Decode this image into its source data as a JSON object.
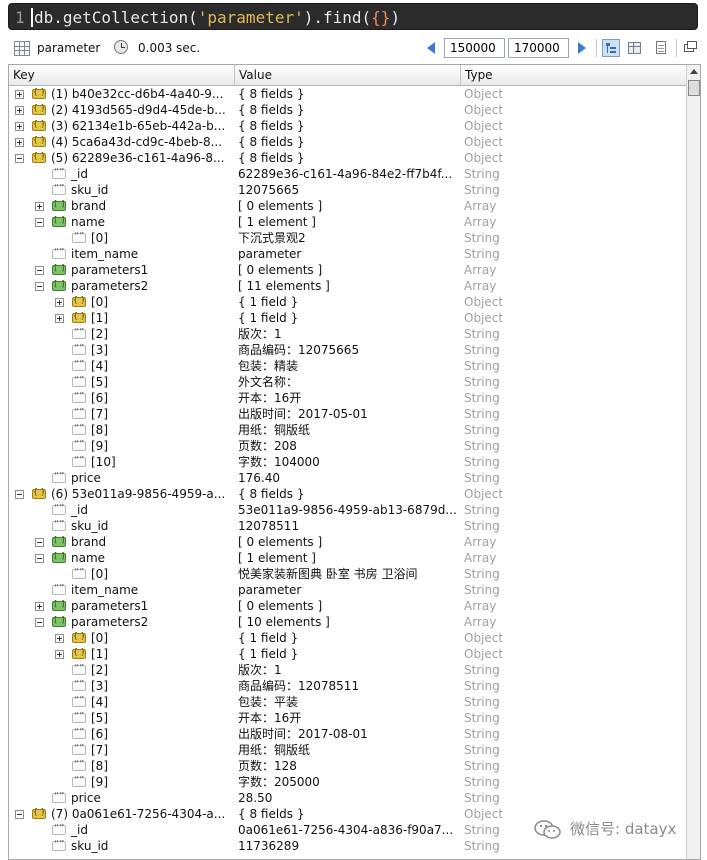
{
  "editor": {
    "line_number": "1",
    "query_prefix": "db.getCollection(",
    "query_string": "'parameter'",
    "query_middle": ").find(",
    "query_braces": "{}",
    "query_suffix": ")"
  },
  "status": {
    "collection": "parameter",
    "exec_time": "0.003 sec.",
    "skip": "150000",
    "limit": "170000"
  },
  "columns": {
    "key": "Key",
    "value": "Value",
    "type": "Type"
  },
  "rows": [
    {
      "depth": 0,
      "exp": "plus",
      "icon": "obj",
      "key": "(1) b40e32cc-d6b4-4a40-9...",
      "value": "{ 8 fields }",
      "type": "Object"
    },
    {
      "depth": 0,
      "exp": "plus",
      "icon": "obj",
      "key": "(2) 4193d565-d9d4-45de-b...",
      "value": "{ 8 fields }",
      "type": "Object"
    },
    {
      "depth": 0,
      "exp": "plus",
      "icon": "obj",
      "key": "(3) 62134e1b-65eb-442a-b...",
      "value": "{ 8 fields }",
      "type": "Object"
    },
    {
      "depth": 0,
      "exp": "plus",
      "icon": "obj",
      "key": "(4) 5ca6a43d-cd9c-4beb-8...",
      "value": "{ 8 fields }",
      "type": "Object"
    },
    {
      "depth": 0,
      "exp": "minus",
      "icon": "obj",
      "key": "(5) 62289e36-c161-4a96-8...",
      "value": "{ 8 fields }",
      "type": "Object"
    },
    {
      "depth": 1,
      "exp": "none",
      "icon": "str",
      "key": "_id",
      "value": "62289e36-c161-4a96-84e2-ff7b4f...",
      "type": "String"
    },
    {
      "depth": 1,
      "exp": "none",
      "icon": "str",
      "key": "sku_id",
      "value": "12075665",
      "type": "String"
    },
    {
      "depth": 1,
      "exp": "plus",
      "icon": "arr",
      "key": "brand",
      "value": "[ 0 elements ]",
      "type": "Array"
    },
    {
      "depth": 1,
      "exp": "minus",
      "icon": "arr",
      "key": "name",
      "value": "[ 1 element ]",
      "type": "Array"
    },
    {
      "depth": 2,
      "exp": "none",
      "icon": "str",
      "key": "[0]",
      "value": "下沉式景观2",
      "type": "String"
    },
    {
      "depth": 1,
      "exp": "none",
      "icon": "str",
      "key": "item_name",
      "value": "parameter",
      "type": "String"
    },
    {
      "depth": 1,
      "exp": "minus",
      "icon": "arr",
      "key": "parameters1",
      "value": "[ 0 elements ]",
      "type": "Array"
    },
    {
      "depth": 1,
      "exp": "minus",
      "icon": "arr",
      "key": "parameters2",
      "value": "[ 11 elements ]",
      "type": "Array"
    },
    {
      "depth": 2,
      "exp": "plus",
      "icon": "obj",
      "key": "[0]",
      "value": "{ 1 field }",
      "type": "Object"
    },
    {
      "depth": 2,
      "exp": "plus",
      "icon": "obj",
      "key": "[1]",
      "value": "{ 1 field }",
      "type": "Object"
    },
    {
      "depth": 2,
      "exp": "none",
      "icon": "str",
      "key": "[2]",
      "value": "版次：1",
      "type": "String"
    },
    {
      "depth": 2,
      "exp": "none",
      "icon": "str",
      "key": "[3]",
      "value": "商品编码：12075665",
      "type": "String"
    },
    {
      "depth": 2,
      "exp": "none",
      "icon": "str",
      "key": "[4]",
      "value": "包装：精装",
      "type": "String"
    },
    {
      "depth": 2,
      "exp": "none",
      "icon": "str",
      "key": "[5]",
      "value": "外文名称：",
      "type": "String"
    },
    {
      "depth": 2,
      "exp": "none",
      "icon": "str",
      "key": "[6]",
      "value": "开本：16开",
      "type": "String"
    },
    {
      "depth": 2,
      "exp": "none",
      "icon": "str",
      "key": "[7]",
      "value": "出版时间：2017-05-01",
      "type": "String"
    },
    {
      "depth": 2,
      "exp": "none",
      "icon": "str",
      "key": "[8]",
      "value": "用纸：铜版纸",
      "type": "String"
    },
    {
      "depth": 2,
      "exp": "none",
      "icon": "str",
      "key": "[9]",
      "value": "页数：208",
      "type": "String"
    },
    {
      "depth": 2,
      "exp": "none",
      "icon": "str",
      "key": "[10]",
      "value": "字数：104000",
      "type": "String"
    },
    {
      "depth": 1,
      "exp": "none",
      "icon": "str",
      "key": "price",
      "value": "176.40",
      "type": "String"
    },
    {
      "depth": 0,
      "exp": "minus",
      "icon": "obj",
      "key": "(6) 53e011a9-9856-4959-a...",
      "value": "{ 8 fields }",
      "type": "Object"
    },
    {
      "depth": 1,
      "exp": "none",
      "icon": "str",
      "key": "_id",
      "value": "53e011a9-9856-4959-ab13-6879d...",
      "type": "String"
    },
    {
      "depth": 1,
      "exp": "none",
      "icon": "str",
      "key": "sku_id",
      "value": "12078511",
      "type": "String"
    },
    {
      "depth": 1,
      "exp": "minus",
      "icon": "arr",
      "key": "brand",
      "value": "[ 0 elements ]",
      "type": "Array"
    },
    {
      "depth": 1,
      "exp": "minus",
      "icon": "arr",
      "key": "name",
      "value": "[ 1 element ]",
      "type": "Array"
    },
    {
      "depth": 2,
      "exp": "none",
      "icon": "str",
      "key": "[0]",
      "value": "悦美家装新图典 卧室 书房 卫浴间",
      "type": "String"
    },
    {
      "depth": 1,
      "exp": "none",
      "icon": "str",
      "key": "item_name",
      "value": "parameter",
      "type": "String"
    },
    {
      "depth": 1,
      "exp": "plus",
      "icon": "arr",
      "key": "parameters1",
      "value": "[ 0 elements ]",
      "type": "Array"
    },
    {
      "depth": 1,
      "exp": "minus",
      "icon": "arr",
      "key": "parameters2",
      "value": "[ 10 elements ]",
      "type": "Array"
    },
    {
      "depth": 2,
      "exp": "plus",
      "icon": "obj",
      "key": "[0]",
      "value": "{ 1 field }",
      "type": "Object"
    },
    {
      "depth": 2,
      "exp": "plus",
      "icon": "obj",
      "key": "[1]",
      "value": "{ 1 field }",
      "type": "Object"
    },
    {
      "depth": 2,
      "exp": "none",
      "icon": "str",
      "key": "[2]",
      "value": "版次：1",
      "type": "String"
    },
    {
      "depth": 2,
      "exp": "none",
      "icon": "str",
      "key": "[3]",
      "value": "商品编码：12078511",
      "type": "String"
    },
    {
      "depth": 2,
      "exp": "none",
      "icon": "str",
      "key": "[4]",
      "value": "包装：平装",
      "type": "String"
    },
    {
      "depth": 2,
      "exp": "none",
      "icon": "str",
      "key": "[5]",
      "value": "开本：16开",
      "type": "String"
    },
    {
      "depth": 2,
      "exp": "none",
      "icon": "str",
      "key": "[6]",
      "value": "出版时间：2017-08-01",
      "type": "String"
    },
    {
      "depth": 2,
      "exp": "none",
      "icon": "str",
      "key": "[7]",
      "value": "用纸：铜版纸",
      "type": "String"
    },
    {
      "depth": 2,
      "exp": "none",
      "icon": "str",
      "key": "[8]",
      "value": "页数：128",
      "type": "String"
    },
    {
      "depth": 2,
      "exp": "none",
      "icon": "str",
      "key": "[9]",
      "value": "字数：205000",
      "type": "String"
    },
    {
      "depth": 1,
      "exp": "none",
      "icon": "str",
      "key": "price",
      "value": "28.50",
      "type": "String"
    },
    {
      "depth": 0,
      "exp": "minus",
      "icon": "obj",
      "key": "(7) 0a061e61-7256-4304-a...",
      "value": "{ 8 fields }",
      "type": "Object"
    },
    {
      "depth": 1,
      "exp": "none",
      "icon": "str",
      "key": "_id",
      "value": "0a061e61-7256-4304-a836-f90a7...",
      "type": "String"
    },
    {
      "depth": 1,
      "exp": "none",
      "icon": "str",
      "key": "sku_id",
      "value": "11736289",
      "type": "String"
    }
  ],
  "watermark": {
    "text": "微信号: datayx"
  }
}
